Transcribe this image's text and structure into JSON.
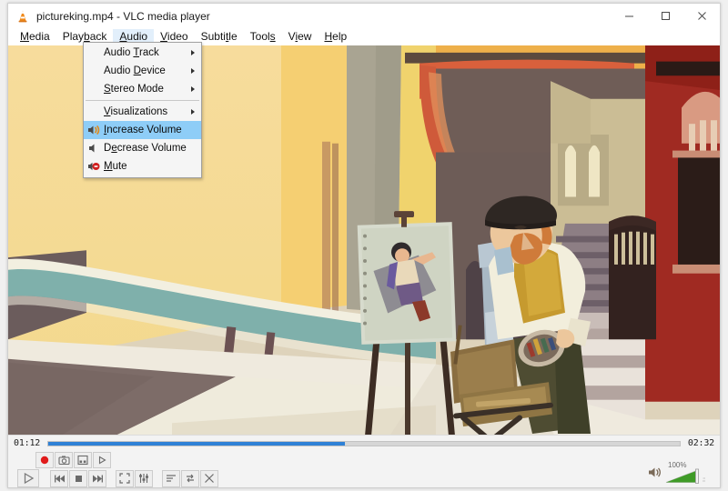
{
  "window": {
    "title": "pictureking.mp4 - VLC media player",
    "app_icon": "vlc-cone-icon",
    "controls": {
      "minimize": "minimize-icon",
      "maximize": "maximize-icon",
      "close": "close-icon"
    }
  },
  "menubar": {
    "items": [
      {
        "label": "Media",
        "accel": "M",
        "active": false
      },
      {
        "label": "Playback",
        "accel": "P",
        "active": false
      },
      {
        "label": "Audio",
        "accel": "A",
        "active": true
      },
      {
        "label": "Video",
        "accel": "V",
        "active": false
      },
      {
        "label": "Subtitle",
        "accel": "S",
        "active": false
      },
      {
        "label": "Tools",
        "accel": "s",
        "active": false
      },
      {
        "label": "View",
        "accel": "i",
        "active": false
      },
      {
        "label": "Help",
        "accel": "H",
        "active": false
      }
    ]
  },
  "audio_menu": {
    "items": [
      {
        "label": "Audio Track",
        "submenu": true,
        "icon": "",
        "selected": false
      },
      {
        "label": "Audio Device",
        "submenu": true,
        "icon": "",
        "selected": false
      },
      {
        "label": "Stereo Mode",
        "submenu": true,
        "icon": "",
        "selected": false
      },
      {
        "separator": true
      },
      {
        "label": "Visualizations",
        "submenu": true,
        "icon": "",
        "selected": false
      },
      {
        "label": "Increase Volume",
        "submenu": false,
        "icon": "volume-up-icon",
        "selected": true
      },
      {
        "label": "Decrease Volume",
        "submenu": false,
        "icon": "volume-down-icon",
        "selected": false
      },
      {
        "label": "Mute",
        "submenu": false,
        "icon": "mute-icon",
        "selected": false
      }
    ]
  },
  "player": {
    "elapsed": "01:12",
    "total": "02:32",
    "progress_percent": 47,
    "volume_percent": "100%",
    "volume_value": 100,
    "accent_color": "#2f81d6",
    "volume_color": "#3f9b27",
    "buttons_top": [
      {
        "name": "record-button",
        "icon": "record-icon"
      },
      {
        "name": "snapshot-button",
        "icon": "camera-icon"
      },
      {
        "name": "frame-by-frame-button",
        "icon": "frame-icon"
      },
      {
        "name": "ab-loop-button",
        "icon": "play-small-icon"
      }
    ],
    "buttons_transport": [
      {
        "name": "previous-button",
        "icon": "previous-icon"
      },
      {
        "name": "stop-button",
        "icon": "stop-icon"
      },
      {
        "name": "next-button",
        "icon": "next-icon"
      }
    ],
    "buttons_view": [
      {
        "name": "fullscreen-button",
        "icon": "fullscreen-icon"
      },
      {
        "name": "extended-settings-button",
        "icon": "equalizer-icon"
      }
    ],
    "buttons_playlist": [
      {
        "name": "playlist-button",
        "icon": "playlist-icon"
      },
      {
        "name": "loop-button",
        "icon": "loop-icon"
      },
      {
        "name": "shuffle-button",
        "icon": "shuffle-icon"
      }
    ],
    "play_button": {
      "name": "play-button",
      "icon": "play-icon"
    }
  },
  "video": {
    "description": "Animated illustration of a bearded painter in a beret working at an easel in a sunlit Mediterranean alley with yellow and red buildings, arches and stone steps."
  }
}
